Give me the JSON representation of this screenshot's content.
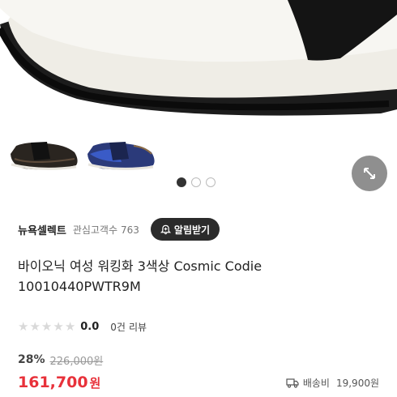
{
  "product_image": {
    "dots": [
      {
        "active": true
      },
      {
        "active": false
      },
      {
        "active": false
      }
    ],
    "thumbnails": [
      "black-shoe",
      "navy-blue-shoe"
    ]
  },
  "seller": {
    "name": "뉴욕셀렉트",
    "follow_label": "관심고객수",
    "follow_count": "763",
    "alarm_label": "알림받기"
  },
  "product": {
    "title_line1": "바이오닉 여성 워킹화 3색상 Cosmic Codie",
    "title_line2": "10010440PWTR9M"
  },
  "rating": {
    "value": "0.0",
    "review_count": "0건",
    "review_label": "리뷰",
    "stars_filled": 0,
    "stars_total": 5
  },
  "price": {
    "discount_rate": "28%",
    "original_price": "226,000원",
    "sale_price": "161,700",
    "currency": "원"
  },
  "shipping": {
    "label": "배송비",
    "fee": "19,900원"
  },
  "colors": {
    "accent_red": "#e8313a",
    "dark_button": "#2b2b2b"
  }
}
